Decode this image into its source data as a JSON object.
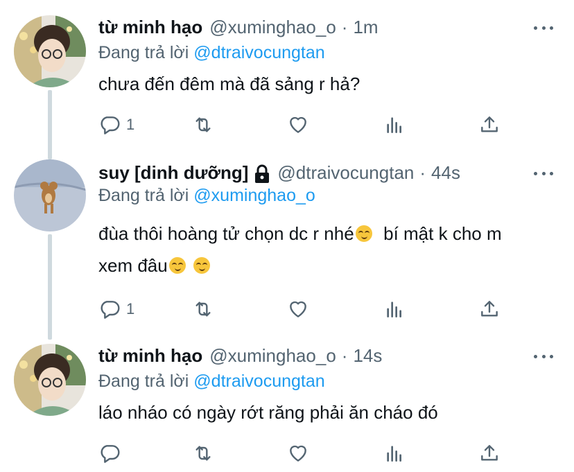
{
  "tweets": [
    {
      "name": "từ minh hạo",
      "handle": "@xuminghao_o",
      "separator": "·",
      "time": "1m",
      "reply_prefix": "Đang trả lời",
      "reply_to": "@dtraivocungtan",
      "text_line1": "chưa đến đêm mà đã sảng r hả?",
      "reply_count": "1",
      "locked": false
    },
    {
      "name": "suy [dinh dưỡng]",
      "handle": "@dtraivocungtan",
      "separator": "·",
      "time": "44s",
      "reply_prefix": "Đang trả lời",
      "reply_to": "@xuminghao_o",
      "text_line1": "đùa thôi hoàng tử chọn dc r nhé",
      "text_line1_b": "  bí mật k cho m",
      "text_line2": "xem đâu",
      "reply_count": "1",
      "locked": true
    },
    {
      "name": "từ minh hạo",
      "handle": "@xuminghao_o",
      "separator": "·",
      "time": "14s",
      "reply_prefix": "Đang trả lời",
      "reply_to": "@dtraivocungtan",
      "text_line1": "láo nháo có ngày rớt răng phải ăn cháo đó",
      "reply_count": "",
      "locked": false
    }
  ],
  "icons": {
    "reply": "reply-icon",
    "retweet": "retweet-icon",
    "like": "heart-icon",
    "analytics": "analytics-icon",
    "share": "share-icon",
    "more": "more-icon",
    "lock": "lock-icon",
    "emoji": "smirking-face-emoji"
  },
  "colors": {
    "link": "#1d9bf0",
    "secondary_text": "#536471",
    "thread_line": "#cfd9de"
  }
}
